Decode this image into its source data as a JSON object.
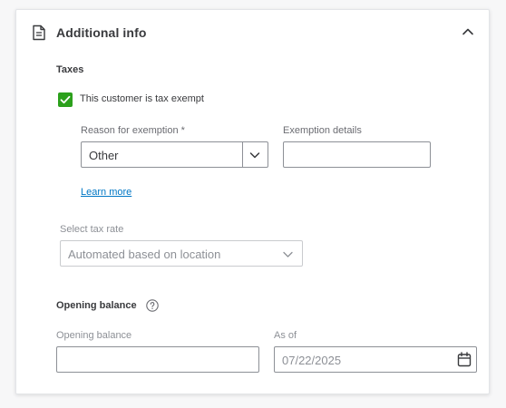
{
  "section": {
    "title": "Additional info",
    "icons": {
      "doc": "document-icon",
      "collapse": "chevron-up-icon"
    }
  },
  "taxes": {
    "heading": "Taxes",
    "exempt_checkbox": {
      "label": "This customer is tax exempt",
      "checked": true,
      "color": "#2ca01c"
    },
    "reason": {
      "label": "Reason for exemption *",
      "value": "Other"
    },
    "details": {
      "label": "Exemption details",
      "value": ""
    },
    "learn_more": "Learn more",
    "tax_rate": {
      "label": "Select tax rate",
      "value": "Automated based on location",
      "disabled": true
    }
  },
  "opening": {
    "heading": "Opening balance",
    "balance": {
      "label": "Opening balance",
      "value": ""
    },
    "as_of": {
      "label": "As of",
      "value": "07/22/2025"
    }
  },
  "colors": {
    "link": "#0077c5",
    "accent": "#2ca01c"
  }
}
